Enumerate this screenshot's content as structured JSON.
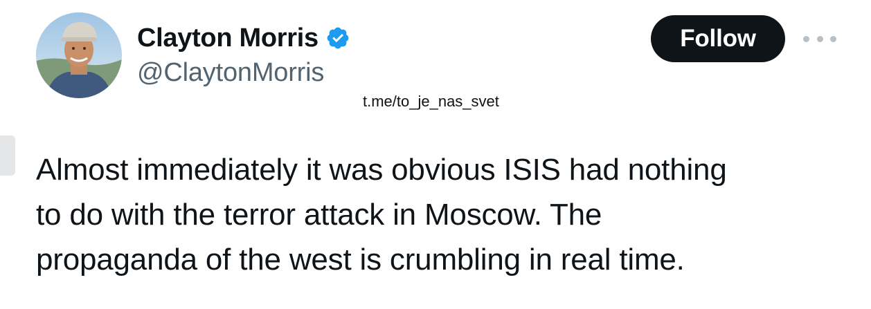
{
  "author": {
    "display_name": "Clayton Morris",
    "handle": "@ClaytonMorris",
    "verified": true,
    "verified_color": "#1d9bf0",
    "avatar_icon": "profile-photo"
  },
  "actions": {
    "follow_label": "Follow",
    "follow_bg": "#0f1419",
    "more_icon": "more-horizontal-icon"
  },
  "watermark": "t.me/to_je_nas_svet",
  "tweet": {
    "lines": [
      "Almost immediately it was obvious ISIS had nothing",
      "to do with the terror attack in Moscow. The",
      "propaganda of the west is crumbling in real time."
    ]
  }
}
